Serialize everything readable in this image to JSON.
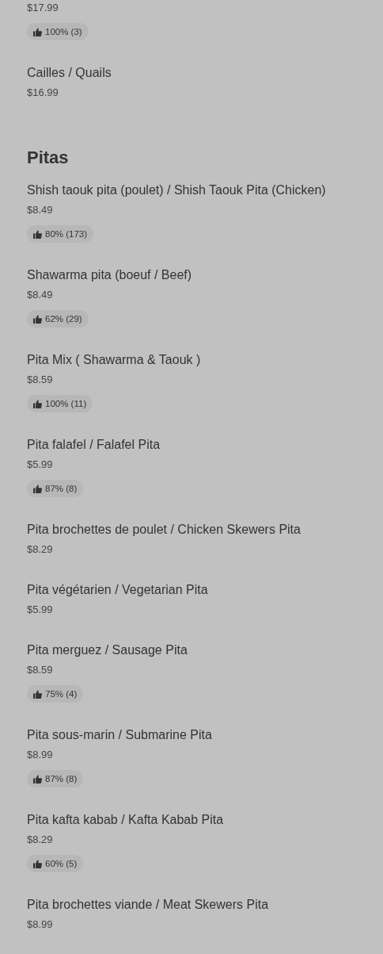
{
  "sections": [
    {
      "items": [
        {
          "price": "$17.99",
          "rating": "100% (3)"
        },
        {
          "name": "Cailles / Quails",
          "price": "$16.99"
        }
      ]
    },
    {
      "title": "Pitas",
      "items": [
        {
          "name": "Shish taouk pita (poulet) / Shish Taouk Pita (Chicken)",
          "price": "$8.49",
          "rating": "80% (173)"
        },
        {
          "name": "Shawarma pita (boeuf / Beef)",
          "price": "$8.49",
          "rating": "62% (29)"
        },
        {
          "name": "Pita Mix ( Shawarma & Taouk )",
          "price": "$8.59",
          "rating": "100% (11)"
        },
        {
          "name": "Pita falafel / Falafel Pita",
          "price": "$5.99",
          "rating": "87% (8)"
        },
        {
          "name": "Pita brochettes de poulet / Chicken Skewers Pita",
          "price": "$8.29"
        },
        {
          "name": "Pita végétarien / Vegetarian Pita",
          "price": "$5.99"
        },
        {
          "name": "Pita merguez / Sausage Pita",
          "price": "$8.59",
          "rating": "75% (4)"
        },
        {
          "name": "Pita sous-marin / Submarine Pita",
          "price": "$8.99",
          "rating": "87% (8)"
        },
        {
          "name": "Pita kafta kabab / Kafta Kabab Pita",
          "price": "$8.29",
          "rating": "60% (5)"
        },
        {
          "name": "Pita brochettes viande / Meat Skewers Pita",
          "price": "$8.99"
        }
      ]
    }
  ]
}
